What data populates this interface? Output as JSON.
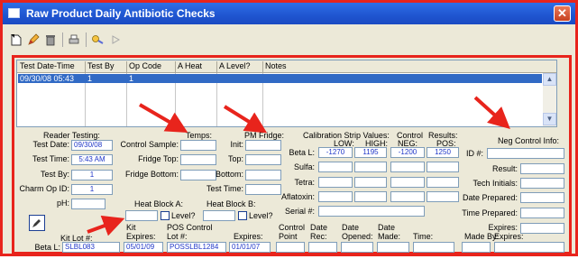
{
  "window": {
    "title": "Raw Product Daily Antibiotic Checks",
    "close_label": "✕"
  },
  "toolbar": {
    "icons": [
      "new-record-icon",
      "edit-icon",
      "delete-icon",
      "print-icon",
      "search-icon",
      "play-icon"
    ]
  },
  "grid": {
    "columns": [
      "Test Date-Time",
      "Test By",
      "Op Code",
      "A Heat",
      "A Level?",
      "Notes"
    ],
    "row": [
      "09/30/08 05:43",
      "1",
      "1",
      "",
      "",
      ""
    ]
  },
  "reader": {
    "heading": "Reader Testing:",
    "test_date_label": "Test Date:",
    "test_date": "09/30/08",
    "test_time_label": "Test Time:",
    "test_time": "5:43 AM",
    "test_by_label": "Test By:",
    "test_by": "1",
    "charm_label": "Charm Op ID:",
    "charm": "1",
    "ph_label": "pH:",
    "ph": ""
  },
  "temps": {
    "heading": "Temps:",
    "control_sample_label": "Control Sample:",
    "fridge_top_label": "Fridge Top:",
    "fridge_bottom_label": "Fridge Bottom:"
  },
  "pm_fridge": {
    "heading": "PM Fridge:",
    "init_label": "Init:",
    "top_label": "Top:",
    "bottom_label": "Bottom:",
    "test_time_label": "Test Time:"
  },
  "calibration": {
    "heading": "Calibration Strip Values:",
    "control_heading": "Control",
    "results_heading": "Results:",
    "low_label": "LOW:",
    "high_label": "HIGH:",
    "neg_label": "NEG:",
    "pos_label": "POS:",
    "beta_label": "Beta L:",
    "beta_low": "-1270",
    "beta_high": "1195",
    "beta_neg": "-1200",
    "beta_pos": "1250",
    "sulfa_label": "Sulfa:",
    "tetra_label": "Tetra:",
    "aflatoxin_label": "Aflatoxin:",
    "serial_label": "Serial #:"
  },
  "neg_control": {
    "heading": "Neg Control Info:",
    "id_label": "ID #:",
    "result_label": "Result:",
    "tech_label": "Tech Initials:",
    "date_prepared_label": "Date Prepared:",
    "time_prepared_label": "Time Prepared:",
    "expires_label": "Expires:"
  },
  "heat": {
    "block_a_label": "Heat Block A:",
    "block_b_label": "Heat Block B:",
    "level_label": "Level?"
  },
  "kit": {
    "kit_lot_label": "Kit Lot #:",
    "kit_expires_label_1": "Kit",
    "kit_expires_label_2": "Expires:",
    "pos_control_label_1": "POS Control",
    "pos_control_label_2": "Lot #:",
    "expires_label": "Expires:",
    "control_point_label_1": "Control",
    "control_point_label_2": "Point",
    "date_rec_label_1": "Date",
    "date_rec_label_2": "Rec:",
    "date_opened_label_1": "Date",
    "date_opened_label_2": "Opened:",
    "date_made_label_1": "Date",
    "date_made_label_2": "Made:",
    "time_label": "Time:",
    "made_by_label": "Made By:",
    "made_by_expires_label": "Expires:",
    "beta_label": "Beta L:",
    "kit_lot": "SLBL083",
    "kit_expires": "05/01/09",
    "pos_lot": "POSSLBL1284",
    "pos_expires": "01/01/07"
  },
  "colors": {
    "annotation": "#e8241c",
    "title_bar": "#1f55d0",
    "value_text": "#1f36c8"
  }
}
